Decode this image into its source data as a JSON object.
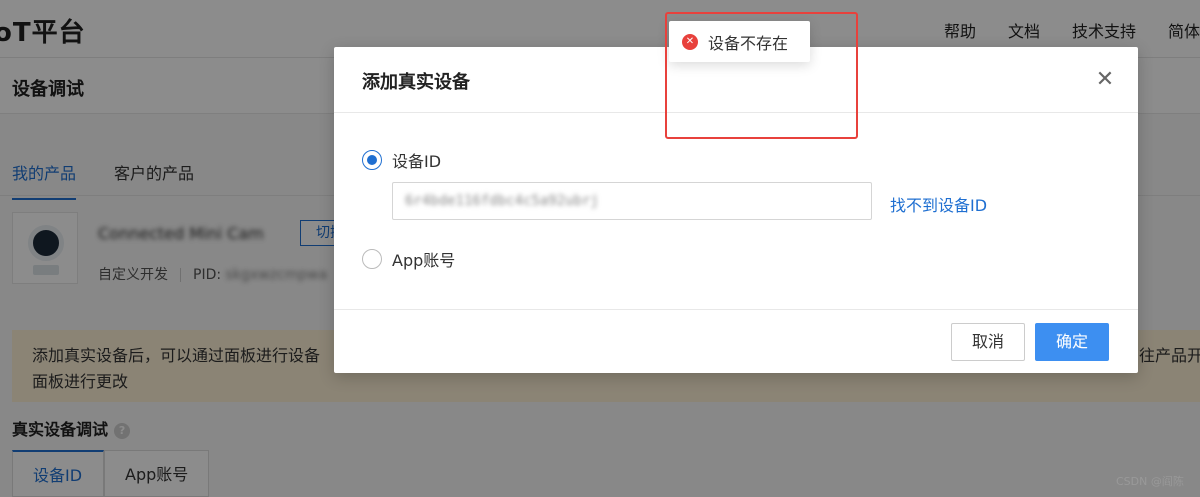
{
  "app": {
    "brand": "oT平台",
    "nav": [
      "帮助",
      "文档",
      "技术支持",
      "简体"
    ]
  },
  "page": {
    "title": "设备调试",
    "tabs": [
      {
        "label": "我的产品",
        "active": true
      },
      {
        "label": "客户的产品",
        "active": false
      }
    ],
    "product": {
      "name": "Connected Mini Cam",
      "switch_label": "切换",
      "dev_type": "自定义开发",
      "pid_label": "PID:",
      "pid_value": "skgxwzcmpwa"
    },
    "notice": {
      "line1": "添加真实设备后，可以通过面板进行设备",
      "line2": "面板进行更改",
      "right": "往产品开"
    },
    "section_title": "真实设备调试",
    "help_icon": "question-icon",
    "subtabs": [
      {
        "label": "设备ID",
        "active": true
      },
      {
        "label": "App账号",
        "active": false
      }
    ]
  },
  "modal": {
    "title": "添加真实设备",
    "close_icon": "close-icon",
    "options": [
      {
        "label": "设备ID",
        "checked": true
      },
      {
        "label": "App账号",
        "checked": false
      }
    ],
    "device_id_value": "6r4bde116fdbc4c5a92ubrj",
    "find_link": "找不到设备ID",
    "cancel_label": "取消",
    "ok_label": "确定"
  },
  "toast": {
    "message": "设备不存在",
    "icon": "error-icon",
    "icon_color": "#e8413c"
  },
  "watermark": "CSDN @阎陈",
  "colors": {
    "accent": "#1f6fd1",
    "primary_button": "#3d8ff1",
    "error": "#e8413c",
    "notice_bg": "#fdf1d6"
  }
}
